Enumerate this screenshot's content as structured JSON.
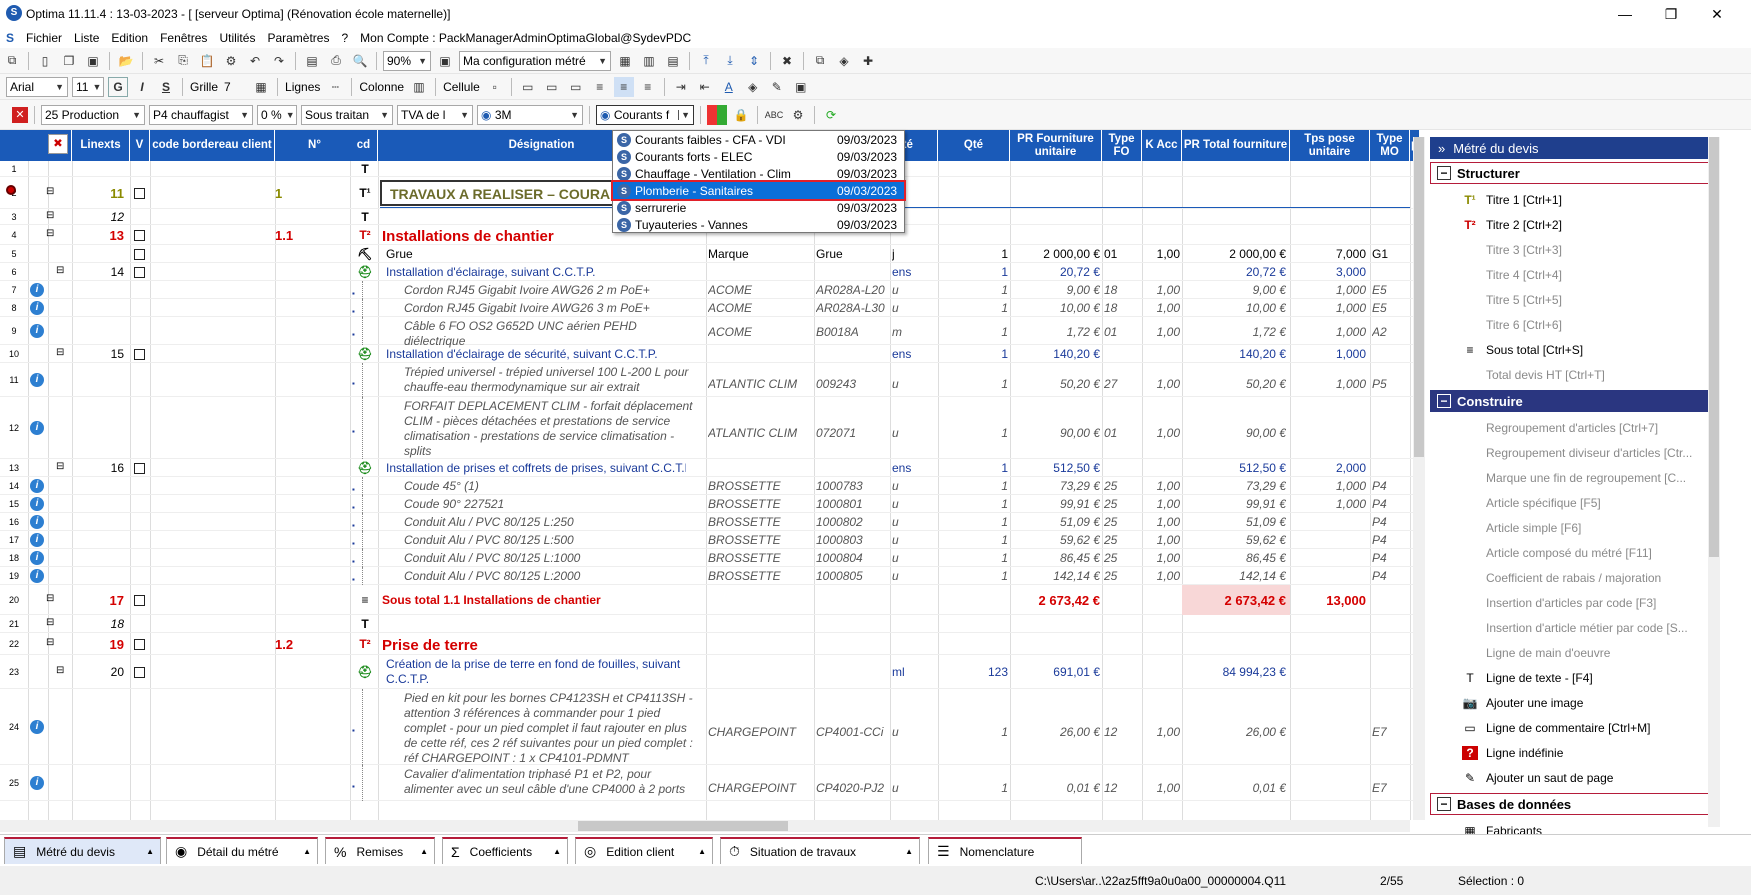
{
  "app": {
    "title": "Optima 11.11.4 : 13-03-2023 - [ [serveur Optima] (Rénovation école maternelle)]",
    "win_min": "—",
    "win_max": "❐",
    "win_close": "✕"
  },
  "menu": [
    "Fichier",
    "Liste",
    "Edition",
    "Fenêtres",
    "Utilités",
    "Paramètres",
    "?",
    "Mon Compte : PackManagerAdminOptimaGlobal@SydevPDC"
  ],
  "toolbar1": {
    "zoom": "90%",
    "config": "Ma configuration métré"
  },
  "toolbar2": {
    "font": "Arial",
    "size": "11",
    "bold": "G",
    "italic": "I",
    "underline": "S",
    "grille_label": "Grille",
    "grille_val": "7",
    "lignes_label": "Lignes",
    "colonne_label": "Colonne",
    "cellule_label": "Cellule"
  },
  "toolbar3": {
    "production": "25  Production",
    "p4": "P4  chauffagist",
    "pct": "0 %",
    "sous_traitant": "Sous traitan",
    "tva": "TVA de l",
    "code3m": "3M",
    "courants": "Courants f"
  },
  "grid": {
    "headers": [
      "Linexts",
      "V",
      "code bordereau client",
      "N°",
      "cd",
      "Désignation",
      "Unité",
      "Qté",
      "PR Fourniture unitaire",
      "Type FO",
      "K Acc",
      "PR Total fourniture",
      "Tps pose unitaire",
      "Type MO",
      "p"
    ],
    "rows": [
      {
        "n": "1",
        "type": "text"
      },
      {
        "n": "2",
        "lin": "11",
        "num": "1",
        "des": "TRAVAUX A REALISER – COURA",
        "type": "t1"
      },
      {
        "n": "3",
        "lin": "12",
        "type": "text"
      },
      {
        "n": "4",
        "lin": "13",
        "num": "1.1",
        "des": "Installations de chantier",
        "type": "t2"
      },
      {
        "n": "5",
        "des": "Grue",
        "marque": "Marque",
        "ref": "Grue",
        "u": "j",
        "q": "1",
        "pf": "2 000,00 €",
        "tf": "01",
        "k": "1,00",
        "pt": "2 000,00 €",
        "tp": "7,000",
        "tm": "G1",
        "type": "art"
      },
      {
        "n": "6",
        "lin": "14",
        "des": "Installation d'éclairage, suivant C.C.T.P.",
        "u": "ens",
        "q": "1",
        "pf": "20,72 €",
        "pt": "20,72 €",
        "tp": "3,000",
        "type": "comp"
      },
      {
        "n": "7",
        "des": "Cordon RJ45 Gigabit Ivoire AWG26 2 m PoE+",
        "marque": "ACOME",
        "ref": "AR028A-L20",
        "u": "u",
        "q": "1",
        "pf": "9,00 €",
        "tf": "18",
        "k": "1,00",
        "pt": "9,00 €",
        "tp": "1,000",
        "tm": "E5",
        "type": "sub"
      },
      {
        "n": "8",
        "des": "Cordon RJ45 Gigabit Ivoire AWG26 3 m PoE+",
        "marque": "ACOME",
        "ref": "AR028A-L30",
        "u": "u",
        "q": "1",
        "pf": "10,00 €",
        "tf": "18",
        "k": "1,00",
        "pt": "10,00 €",
        "tp": "1,000",
        "tm": "E5",
        "type": "sub"
      },
      {
        "n": "9",
        "des": "Câble 6 FO OS2 G652D UNC aérien PEHD",
        "des2": "diélectrique",
        "marque": "ACOME",
        "ref": "B0018A",
        "u": "m",
        "q": "1",
        "pf": "1,72 €",
        "tf": "01",
        "k": "1,00",
        "pt": "1,72 €",
        "tp": "1,000",
        "tm": "A2",
        "type": "sub"
      },
      {
        "n": "10",
        "lin": "15",
        "des": "Installation d'éclairage de sécurité, suivant C.C.T.P.",
        "u": "ens",
        "q": "1",
        "pf": "140,20 €",
        "pt": "140,20 €",
        "tp": "1,000",
        "type": "comp"
      },
      {
        "n": "11",
        "des": "Trépied universel - trépied universel 100 L-200 L pour",
        "des2": "chauffe-eau thermodynamique sur air extrait",
        "marque": "ATLANTIC CLIM",
        "ref": "009243",
        "u": "u",
        "q": "1",
        "pf": "50,20 €",
        "tf": "27",
        "k": "1,00",
        "pt": "50,20 €",
        "tp": "1,000",
        "tm": "P5",
        "type": "sub"
      },
      {
        "n": "12",
        "des": "FORFAIT DEPLACEMENT CLIM - forfait déplacement",
        "des2": "CLIM - pièces détachées et prestations de service",
        "des3": "climatisation - prestations de service climatisation -",
        "des4": "splits",
        "marque": "ATLANTIC CLIM",
        "ref": "072071",
        "u": "u",
        "q": "1",
        "pf": "90,00 €",
        "tf": "01",
        "k": "1,00",
        "pt": "90,00 €",
        "type": "sub"
      },
      {
        "n": "13",
        "lin": "16",
        "des": "Installation de prises et coffrets de prises, suivant C.C.T.P.",
        "u": "ens",
        "q": "1",
        "pf": "512,50 €",
        "pt": "512,50 €",
        "tp": "2,000",
        "type": "comp"
      },
      {
        "n": "14",
        "des": "Coude 45° (1)",
        "marque": "BROSSETTE",
        "ref": "1000783",
        "u": "u",
        "q": "1",
        "pf": "73,29 €",
        "tf": "25",
        "k": "1,00",
        "pt": "73,29 €",
        "tp": "1,000",
        "tm": "P4",
        "type": "sub"
      },
      {
        "n": "15",
        "des": "Coude 90° 227521",
        "marque": "BROSSETTE",
        "ref": "1000801",
        "u": "u",
        "q": "1",
        "pf": "99,91 €",
        "tf": "25",
        "k": "1,00",
        "pt": "99,91 €",
        "tp": "1,000",
        "tm": "P4",
        "type": "sub"
      },
      {
        "n": "16",
        "des": "Conduit Alu / PVC 80/125 L:250",
        "marque": "BROSSETTE",
        "ref": "1000802",
        "u": "u",
        "q": "1",
        "pf": "51,09 €",
        "tf": "25",
        "k": "1,00",
        "pt": "51,09 €",
        "tm": "P4",
        "type": "sub"
      },
      {
        "n": "17",
        "des": "Conduit Alu / PVC 80/125 L:500",
        "marque": "BROSSETTE",
        "ref": "1000803",
        "u": "u",
        "q": "1",
        "pf": "59,62 €",
        "tf": "25",
        "k": "1,00",
        "pt": "59,62 €",
        "tm": "P4",
        "type": "sub"
      },
      {
        "n": "18",
        "des": "Conduit Alu / PVC 80/125 L:1000",
        "marque": "BROSSETTE",
        "ref": "1000804",
        "u": "u",
        "q": "1",
        "pf": "86,45 €",
        "tf": "25",
        "k": "1,00",
        "pt": "86,45 €",
        "tm": "P4",
        "type": "sub"
      },
      {
        "n": "19",
        "des": "Conduit Alu / PVC 80/125 L:2000",
        "marque": "BROSSETTE",
        "ref": "1000805",
        "u": "u",
        "q": "1",
        "pf": "142,14 €",
        "tf": "25",
        "k": "1,00",
        "pt": "142,14 €",
        "tm": "P4",
        "type": "sub"
      },
      {
        "n": "20",
        "lin": "17",
        "des": "Sous total 1.1 Installations de chantier",
        "pf": "2 673,42 €",
        "pt": "2 673,42 €",
        "tp": "13,000",
        "type": "st"
      },
      {
        "n": "21",
        "lin": "18",
        "type": "text"
      },
      {
        "n": "22",
        "lin": "19",
        "num": "1.2",
        "des": "Prise de terre",
        "type": "t2"
      },
      {
        "n": "23",
        "lin": "20",
        "des": "Création de la prise de terre en fond de fouilles, suivant",
        "des2": "C.C.T.P.",
        "u": "ml",
        "q": "123",
        "pf": "691,01 €",
        "pt": "84 994,23 €",
        "type": "comp"
      },
      {
        "n": "24",
        "des": "Pied en kit pour les bornes CP4123SH et CP4113SH -",
        "des2": "attention 3 références à commander pour 1 pied",
        "des3": "complet - pour un pied complet il faut rajouter en plus",
        "des4": "de cette réf, ces 2 réf suivantes pour un pied complet :",
        "des5": "réf CHARGEPOINT : 1 x CP4101-PDMNT",
        "marque": "CHARGEPOINT",
        "ref": "CP4001-CCi",
        "u": "u",
        "q": "1",
        "pf": "26,00 €",
        "tf": "12",
        "k": "1,00",
        "pt": "26,00 €",
        "tm": "E7",
        "type": "sub"
      },
      {
        "n": "25",
        "des": "Cavalier d'alimentation triphasé P1 et P2, pour",
        "des2": "alimenter avec un seul câble d'une CP4000 à 2 ports",
        "marque": "CHARGEPOINT",
        "ref": "CP4020-PJ2",
        "u": "u",
        "q": "1",
        "pf": "0,01 €",
        "tf": "12",
        "k": "1,00",
        "pt": "0,01 €",
        "tm": "E7",
        "type": "sub"
      }
    ]
  },
  "popup": [
    {
      "name": "Courants faibles - CFA - VDI",
      "date": "09/03/2023"
    },
    {
      "name": "Courants forts - ELEC",
      "date": "09/03/2023"
    },
    {
      "name": "Chauffage - Ventilation - Clim",
      "date": "09/03/2023"
    },
    {
      "name": "Plomberie - Sanitaires",
      "date": "09/03/2023",
      "sel": true
    },
    {
      "name": "serrurerie",
      "date": "09/03/2023"
    },
    {
      "name": "Tuyauteries - Vannes",
      "date": "09/03/2023"
    }
  ],
  "right_panel": {
    "title": "Métré du devis",
    "sections": [
      {
        "label": "Structurer",
        "items": [
          {
            "label": "Titre 1 [Ctrl+1]",
            "icon": "T1",
            "dis": false
          },
          {
            "label": "Titre 2 [Ctrl+2]",
            "icon": "T2",
            "dis": false
          },
          {
            "label": "Titre 3 [Ctrl+3]",
            "icon": "",
            "dis": true
          },
          {
            "label": "Titre 4 [Ctrl+4]",
            "icon": "",
            "dis": true
          },
          {
            "label": "Titre 5 [Ctrl+5]",
            "icon": "",
            "dis": true
          },
          {
            "label": "Titre 6 [Ctrl+6]",
            "icon": "",
            "dis": true
          },
          {
            "label": "Sous total [Ctrl+S]",
            "icon": "≡",
            "dis": false
          },
          {
            "label": "Total devis HT [Ctrl+T]",
            "icon": "",
            "dis": true
          }
        ]
      },
      {
        "label": "Construire",
        "sel": true,
        "items": [
          {
            "label": "Regroupement d'articles  [Ctrl+7]",
            "dis": true
          },
          {
            "label": "Regroupement diviseur d'articles [Ctr...",
            "dis": true
          },
          {
            "label": "Marque une fin de regroupement  [C...",
            "dis": true
          },
          {
            "label": "Article spécifique [F5]",
            "dis": true
          },
          {
            "label": "Article simple [F6]",
            "dis": true
          },
          {
            "label": "Article composé du métré [F11]",
            "dis": true
          },
          {
            "label": "Coefficient de rabais / majoration",
            "dis": true
          },
          {
            "label": "Insertion d'articles par code [F3]",
            "dis": true
          },
          {
            "label": "Insertion d'article métier par code [S...",
            "dis": true
          },
          {
            "label": "Ligne de main d'oeuvre",
            "dis": true
          },
          {
            "label": "Ligne de texte - [F4]",
            "icon": "T",
            "dis": false
          },
          {
            "label": "Ajouter une image",
            "icon": "📷",
            "dis": false
          },
          {
            "label": "Ligne de commentaire [Ctrl+M]",
            "icon": "▭",
            "dis": false
          },
          {
            "label": "Ligne indéfinie",
            "icon": "?",
            "dis": false
          },
          {
            "label": "Ajouter un saut de page",
            "icon": "✎",
            "dis": false
          }
        ]
      },
      {
        "label": "Bases de données",
        "items": [
          {
            "label": "Fabricants",
            "icon": "▦",
            "dis": false
          }
        ]
      }
    ]
  },
  "tabs": [
    "Métré du devis",
    "Détail du métré",
    "Remises",
    "Coefficients",
    "Edition client",
    "Situation de travaux",
    "Nomenclature"
  ],
  "status": {
    "path": "C:\\Users\\ar..\\22az5fft9a0u0a00_00000004.Q11",
    "page": "2/55",
    "selection": "Sélection : 0"
  }
}
